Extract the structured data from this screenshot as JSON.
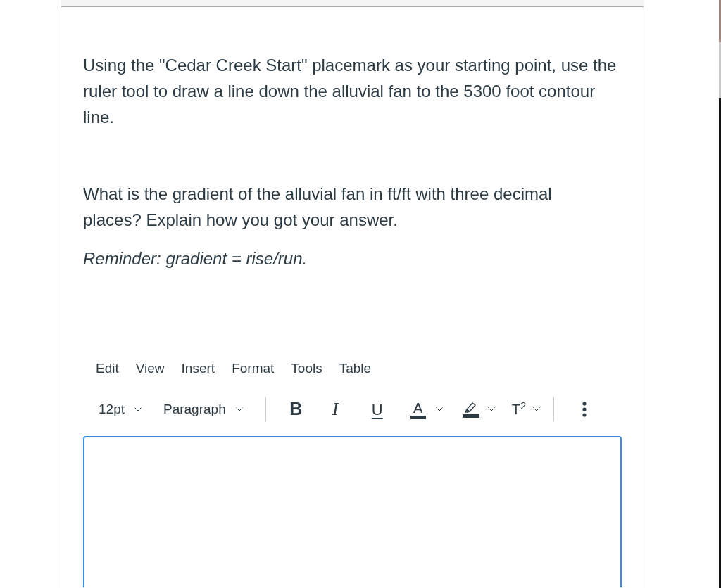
{
  "question": {
    "paragraphs": [
      "Using the \"Cedar Creek Start\" placemark as your starting point, use the ruler tool to draw a line down the alluvial fan to the 5300 foot contour line.",
      "What is the gradient of the alluvial fan in ft/ft with three decimal places? Explain how you got your answer."
    ],
    "reminder": "Reminder: gradient = rise/run."
  },
  "editor": {
    "menu": [
      "Edit",
      "View",
      "Insert",
      "Format",
      "Tools",
      "Table"
    ],
    "toolbar": [
      {
        "kind": "dropdown",
        "label": "12pt"
      },
      {
        "kind": "dropdown",
        "label": "Paragraph"
      },
      {
        "kind": "separator"
      },
      {
        "kind": "bold",
        "label": "B"
      },
      {
        "kind": "italic",
        "label": "I"
      },
      {
        "kind": "underline",
        "label": "U"
      },
      {
        "kind": "text-color",
        "label": "A"
      },
      {
        "kind": "highlight"
      },
      {
        "kind": "superscript",
        "label": "T$^{2}$"
      },
      {
        "kind": "separator"
      },
      {
        "kind": "more"
      }
    ],
    "answer_box": {
      "focused": true
    }
  }
}
